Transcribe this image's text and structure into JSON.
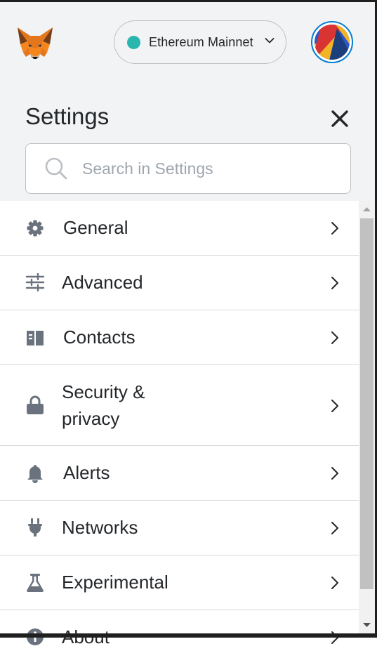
{
  "header": {
    "network": {
      "label": "Ethereum Mainnet",
      "dot_color": "#29b6af"
    },
    "fox_icon": "metamask-fox-icon",
    "avatar_icon": "account-identicon"
  },
  "settings": {
    "title": "Settings",
    "close_icon": "close-icon",
    "search": {
      "placeholder": "Search in Settings",
      "value": ""
    },
    "items": [
      {
        "label": "General",
        "icon": "gear-icon"
      },
      {
        "label": "Advanced",
        "icon": "sliders-icon"
      },
      {
        "label": "Contacts",
        "icon": "address-book-icon"
      },
      {
        "label": "Security &\nprivacy",
        "icon": "lock-icon"
      },
      {
        "label": "Alerts",
        "icon": "bell-icon"
      },
      {
        "label": "Networks",
        "icon": "plug-icon"
      },
      {
        "label": "Experimental",
        "icon": "flask-icon"
      },
      {
        "label": "About",
        "icon": "info-icon"
      }
    ]
  },
  "colors": {
    "accent": "#037dd6",
    "text": "#24272a",
    "icon": "#6a737d",
    "header_bg": "#f2f3f4"
  }
}
